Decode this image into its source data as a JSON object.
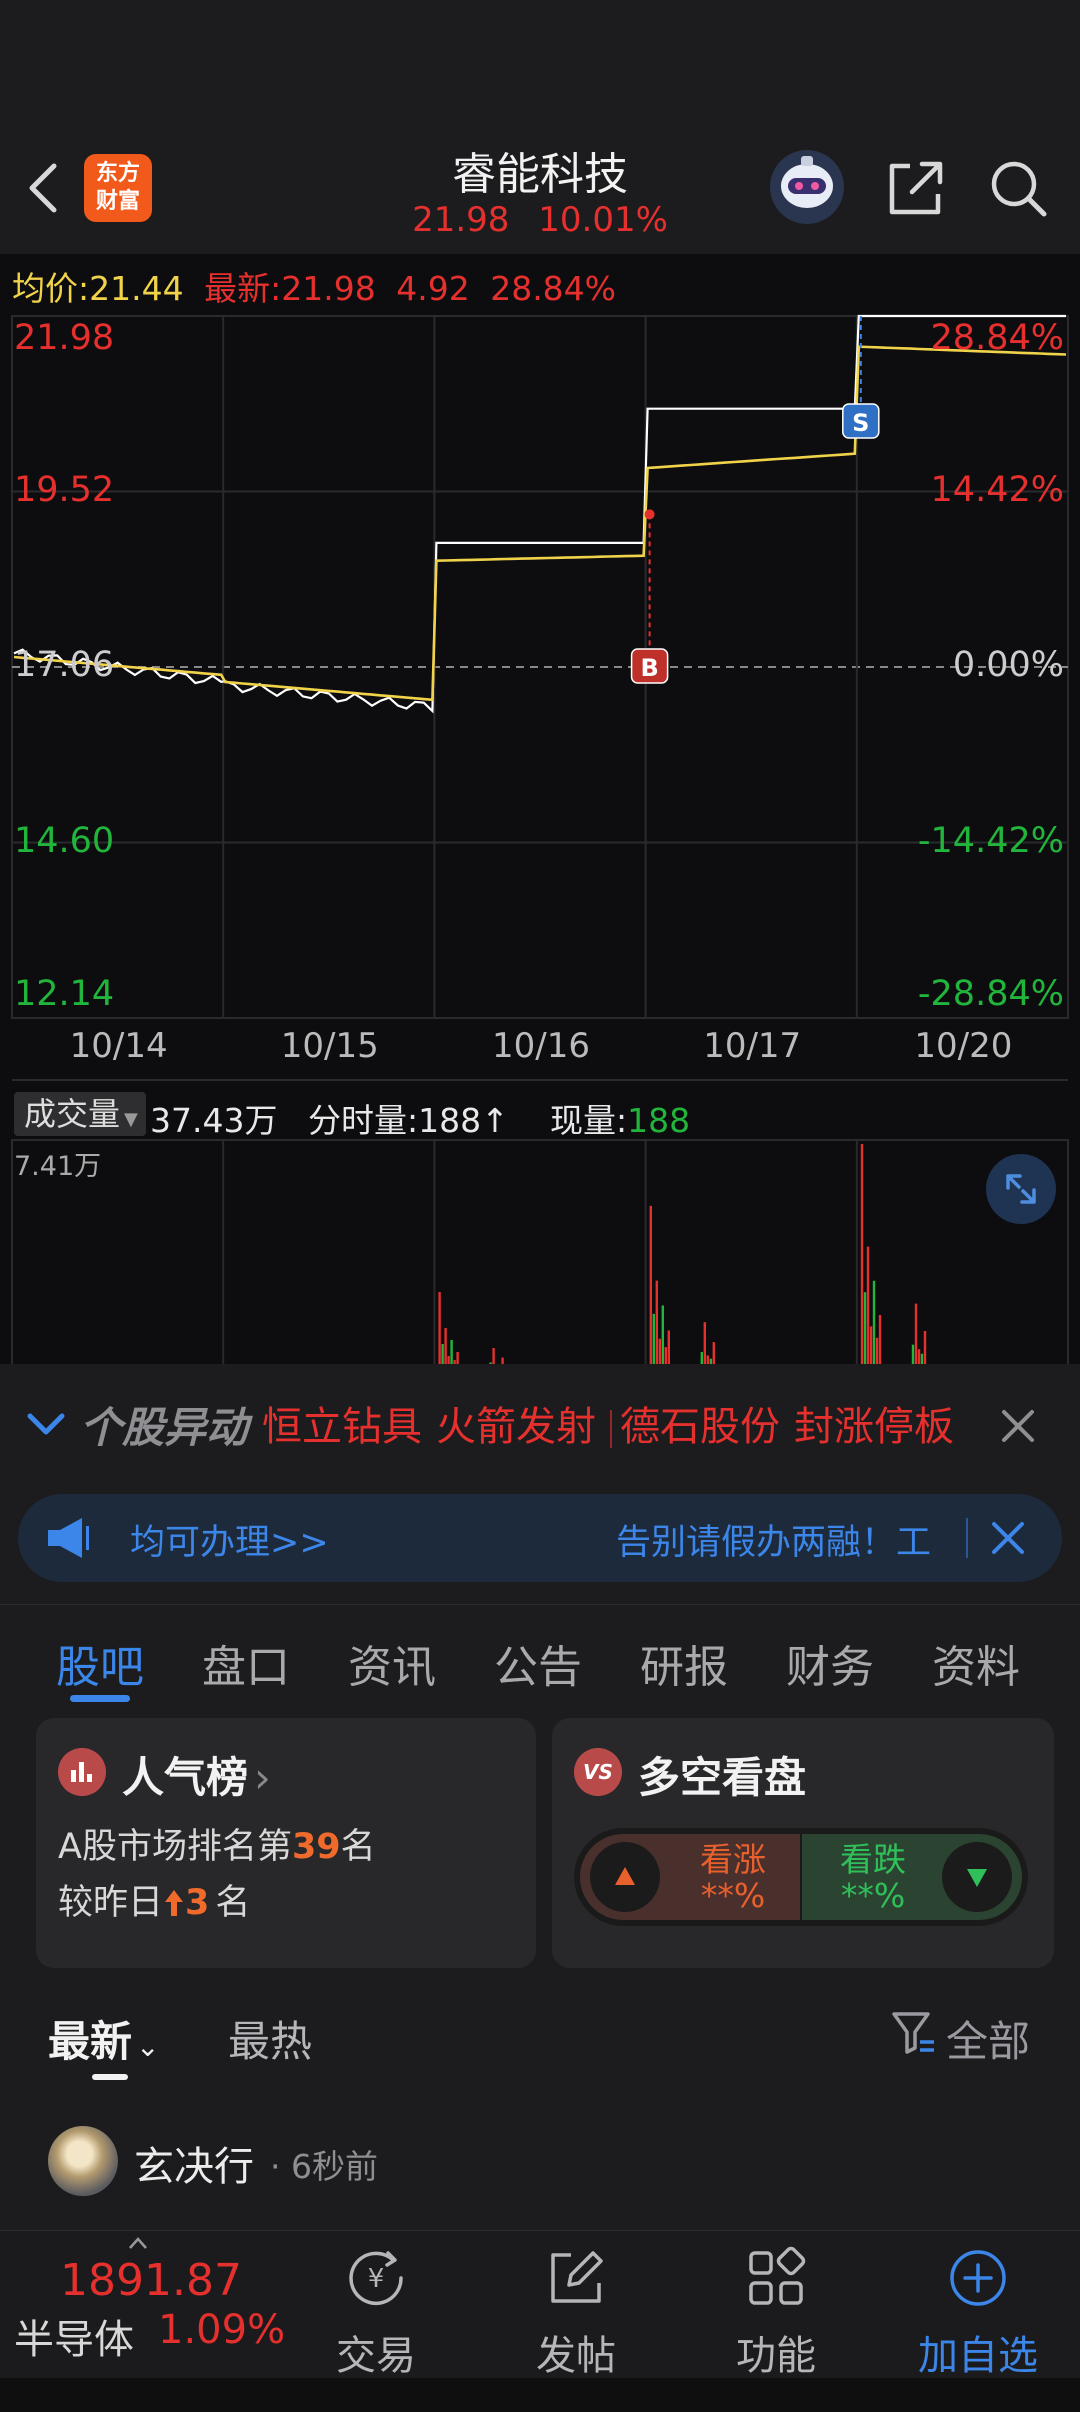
{
  "header": {
    "logo_line1": "东方",
    "logo_line2": "财富",
    "title": "睿能科技",
    "price": "21.98",
    "change_pct": "10.01%"
  },
  "chart_legend": {
    "avg_label": "均价:",
    "avg_value": "21.44",
    "latest_label": "最新:",
    "latest_value": "21.98",
    "change": "4.92",
    "change_pct": "28.84%"
  },
  "chart_data": {
    "type": "line",
    "x_dates": [
      "10/14",
      "10/15",
      "10/16",
      "10/17",
      "10/20"
    ],
    "y_left_ticks": [
      "21.98",
      "19.52",
      "17.06",
      "14.60",
      "12.14"
    ],
    "y_right_ticks": [
      "28.84%",
      "14.42%",
      "0.00%",
      "-14.42%",
      "-28.84%"
    ],
    "ylim": [
      12.14,
      21.98
    ],
    "reference_price": 17.06,
    "series": [
      {
        "name": "",
        "color": "#ffffff",
        "x": [
          "10/14 open",
          "10/14 close",
          "10/15 open",
          "10/15 close",
          "10/16 open",
          "10/16 close",
          "10/17 open",
          "10/17 close",
          "10/20 open",
          "10/20 close"
        ],
        "values": [
          17.25,
          16.85,
          16.8,
          16.5,
          18.8,
          18.8,
          20.68,
          20.68,
          21.98,
          21.98
        ]
      },
      {
        "name": "",
        "color": "#f0d34a",
        "x": [
          "10/14 open",
          "10/14 close",
          "10/15 open",
          "10/15 close",
          "10/16 open",
          "10/16 close",
          "10/17 open",
          "10/17 close",
          "10/20 open",
          "10/20 close"
        ],
        "values": [
          17.2,
          16.95,
          16.85,
          16.6,
          18.55,
          18.62,
          19.85,
          20.05,
          21.55,
          21.44
        ]
      }
    ],
    "markers": [
      {
        "label": "B",
        "date": "10/17",
        "price": 19.2
      },
      {
        "label": "S",
        "date": "10/20",
        "price": 21.98
      }
    ],
    "volume": {
      "max_label": "7.41万",
      "ylim": [
        0,
        7.41
      ],
      "unit": "万",
      "dates": [
        "10/14",
        "10/15",
        "10/16",
        "10/17",
        "10/20"
      ],
      "peaks": [
        0.1,
        0.1,
        2.6,
        5.4,
        7.41
      ]
    }
  },
  "volume_bar": {
    "selector_label": "成交量",
    "total": "37.43万",
    "tick_label": "分时量:188↑",
    "current_label": "现量:",
    "current_value": "188"
  },
  "alert": {
    "brand": "个股异动",
    "items": [
      "恒立钻具",
      "火箭发射",
      "德石股份",
      "封涨停板"
    ]
  },
  "banner": {
    "left_text": "均可办理>>",
    "right_text": "告别请假办两融！工"
  },
  "tabs": [
    "股吧",
    "盘口",
    "资讯",
    "公告",
    "研报",
    "财务",
    "资料"
  ],
  "popularity_card": {
    "title": "人气榜",
    "line1_prefix": "A股市场排名第",
    "rank": "39",
    "line1_suffix": "名",
    "line2_prefix": "较昨日",
    "change": "3",
    "line2_suffix": "名"
  },
  "sentiment_card": {
    "title": "多空看盘",
    "bull_label": "看涨",
    "bull_value": "**%",
    "bear_label": "看跌",
    "bear_value": "**%"
  },
  "feed": {
    "tab_latest": "最新",
    "tab_hot": "最热",
    "filter_label": "全部"
  },
  "post": {
    "author": "玄决行",
    "time": "· 6秒前"
  },
  "bottom_nav": {
    "index_value": "1891.87",
    "index_name": "半导体",
    "index_pct": "1.09%",
    "items": [
      "交易",
      "发帖",
      "功能",
      "加自选"
    ]
  },
  "colors": {
    "up": "#e5302e",
    "down": "#22b53c",
    "accent": "#3b86e8",
    "avg_line": "#f0d34a"
  }
}
